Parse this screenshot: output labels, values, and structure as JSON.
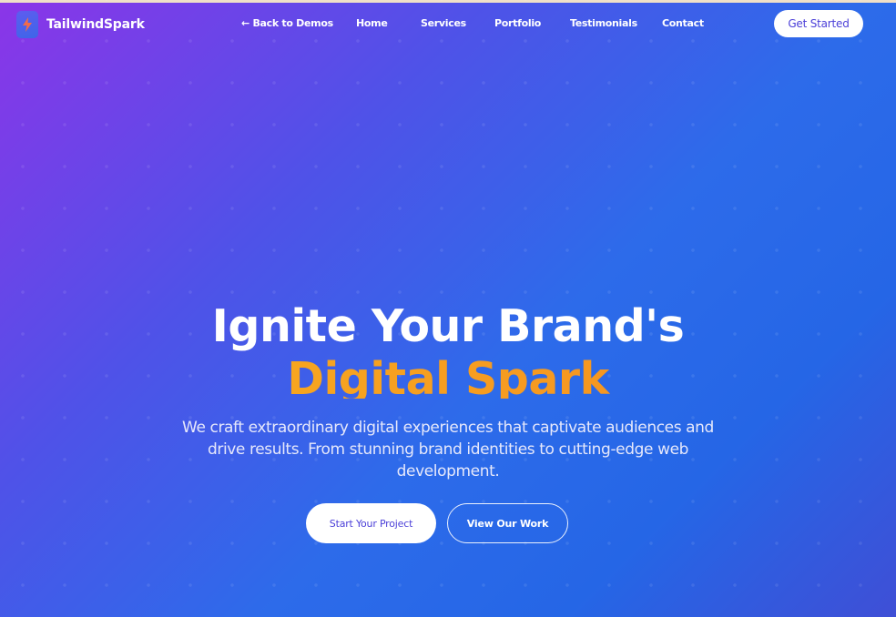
{
  "brand": {
    "name": "TailwindSpark",
    "logo_icon": "lightning-bolt-icon"
  },
  "nav": {
    "back": "← Back to Demos",
    "items": [
      "Home",
      "Services",
      "Portfolio",
      "Testimonials",
      "Contact"
    ],
    "cta": "Get Started"
  },
  "hero": {
    "title_line1": "Ignite Your Brand's",
    "title_line2": "Digital Spark",
    "subtitle": "We craft extraordinary digital experiences that captivate audiences and drive results. From stunning brand identities to cutting-edge web development.",
    "primary_button": "Start Your Project",
    "secondary_button": "View Our Work"
  },
  "colors": {
    "gradient_start": "#8b35e8",
    "gradient_end": "#2566e6",
    "accent": "#f6a51d",
    "button_text": "#4b3fd8"
  }
}
